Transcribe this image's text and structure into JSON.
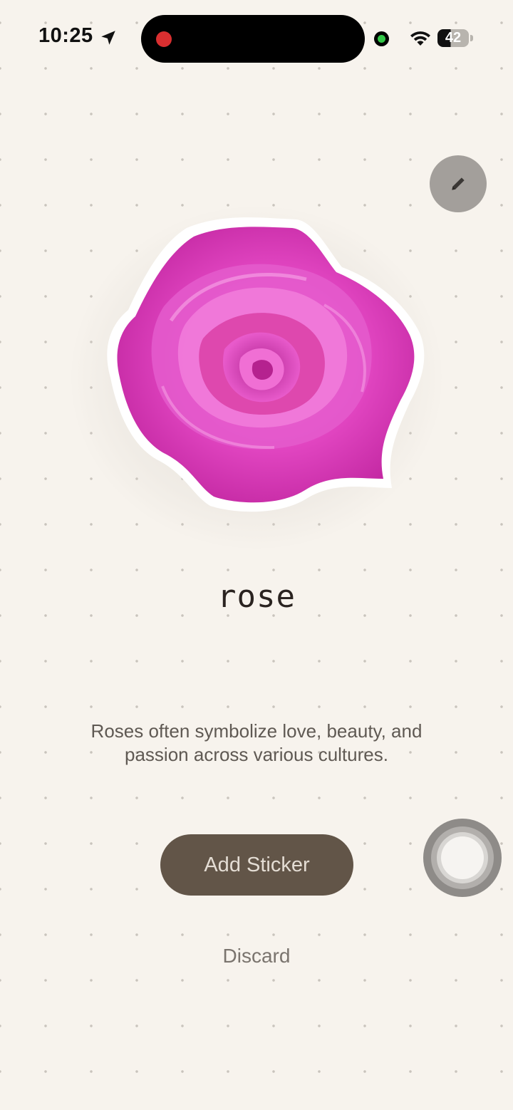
{
  "status_bar": {
    "time": "10:25",
    "battery": "42",
    "icons": [
      "location-arrow-icon",
      "recording-indicator",
      "camera-in-use-indicator",
      "wifi-icon",
      "battery-icon"
    ],
    "colors": {
      "recording": "#d92f30",
      "camera": "#33c748"
    }
  },
  "toolbar": {
    "edit_icon": "pencil-icon"
  },
  "sticker": {
    "image": "rose-sticker",
    "colors": {
      "petal": "#e43fc2",
      "outline": "#ffffff"
    },
    "title": "rose",
    "description": "Roses often symbolize love, beauty, and passion across various cultures."
  },
  "actions": {
    "add_label": "Add Sticker",
    "discard_label": "Discard",
    "colors": {
      "add_bg": "#625548",
      "add_text": "#e4ddd4"
    }
  },
  "overlay": {
    "assistive_touch": "assistive-touch-button"
  },
  "theme": {
    "background": "#f7f3ed",
    "dot_grid": "#c9c4bd"
  }
}
